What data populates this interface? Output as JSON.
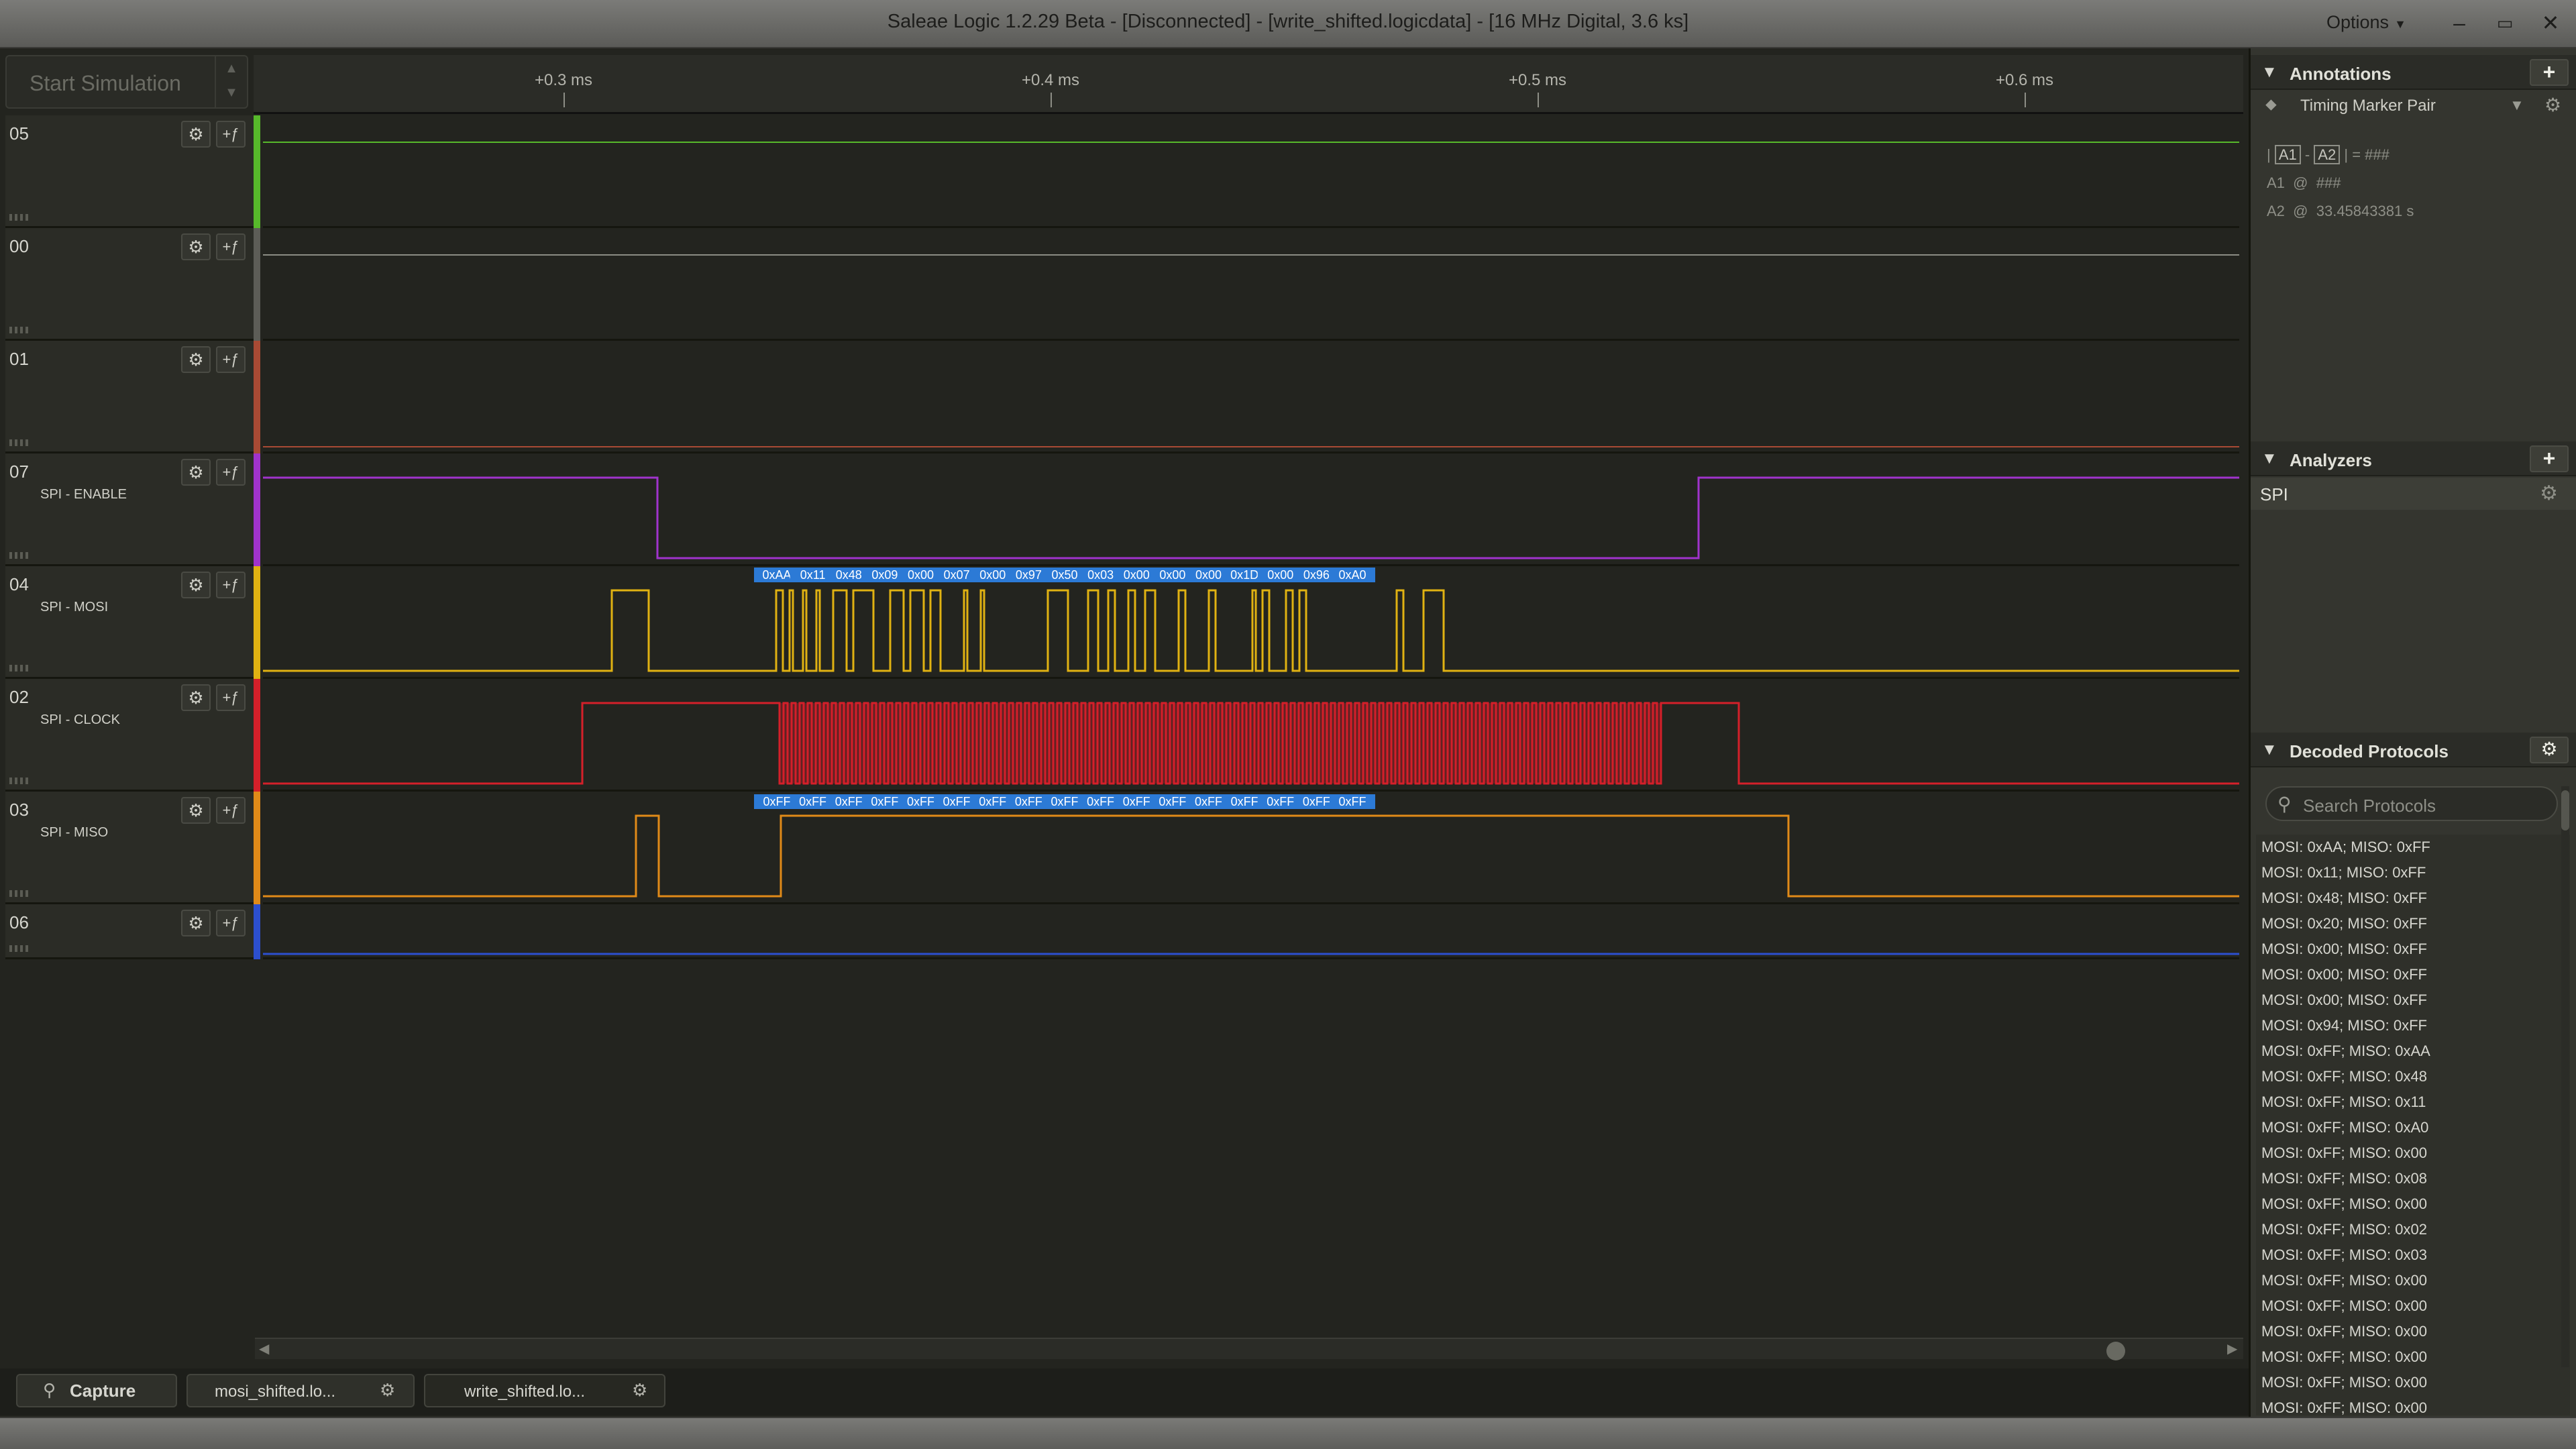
{
  "window": {
    "title": "Saleae Logic 1.2.29 Beta - [Disconnected] - [write_shifted.logicdata] - [16 MHz Digital, 3.6 ks]",
    "options_label": "Options",
    "minimize": "–",
    "restore": "▭",
    "close": "✕"
  },
  "toolbar": {
    "start_simulation": "Start Simulation"
  },
  "ruler": {
    "ticks": [
      "+0.3 ms",
      "+0.4 ms",
      "+0.5 ms",
      "+0.6 ms"
    ]
  },
  "channels": [
    {
      "num": "05",
      "name": "",
      "color": "#57b92b"
    },
    {
      "num": "00",
      "name": "",
      "color": "#5d5d57"
    },
    {
      "num": "01",
      "name": "",
      "color": "#a84a34"
    },
    {
      "num": "07",
      "name": "SPI - ENABLE",
      "color": "#a033cc"
    },
    {
      "num": "04",
      "name": "SPI - MOSI",
      "color": "#e0b212"
    },
    {
      "num": "02",
      "name": "SPI - CLOCK",
      "color": "#d4202a"
    },
    {
      "num": "03",
      "name": "SPI - MISO",
      "color": "#e08a18"
    },
    {
      "num": "06",
      "name": "",
      "color": "#2c4fcf"
    }
  ],
  "mosi_bytes": [
    "0xAA",
    "0x11",
    "0x48",
    "0x09",
    "0x00",
    "0x07",
    "0x00",
    "0x97",
    "0x50",
    "0x03",
    "0x00",
    "0x00",
    "0x00",
    "0x1D",
    "0x00",
    "0x96",
    "0xA0"
  ],
  "miso_bytes": [
    "0xFF",
    "0xFF",
    "0xFF",
    "0xFF",
    "0xFF",
    "0xFF",
    "0xFF",
    "0xFF",
    "0xFF",
    "0xFF",
    "0xFF",
    "0xFF",
    "0xFF",
    "0xFF",
    "0xFF",
    "0xFF",
    "0xFF"
  ],
  "tabs": {
    "capture": "Capture",
    "file1": "mosi_shifted.lo...",
    "file2": "write_shifted.lo..."
  },
  "annotations": {
    "header": "Annotations",
    "add": "+",
    "timing_marker": "Timing Marker Pair",
    "a1": "A1",
    "a2": "A2",
    "dash": "-",
    "equals_value": "= ###",
    "a1_line_at": "@",
    "a1_value": "###",
    "a2_value": "33.45843381 s"
  },
  "analyzers": {
    "header": "Analyzers",
    "add": "+",
    "items": [
      "SPI"
    ]
  },
  "decoded": {
    "header": "Decoded Protocols",
    "search_placeholder": "Search Protocols",
    "items": [
      "MOSI: 0xAA;  MISO: 0xFF",
      "MOSI: 0x11;  MISO: 0xFF",
      "MOSI: 0x48;  MISO: 0xFF",
      "MOSI: 0x20;  MISO: 0xFF",
      "MOSI: 0x00;  MISO: 0xFF",
      "MOSI: 0x00;  MISO: 0xFF",
      "MOSI: 0x00;  MISO: 0xFF",
      "MOSI: 0x94;  MISO: 0xFF",
      "MOSI: 0xFF;  MISO: 0xAA",
      "MOSI: 0xFF;  MISO: 0x48",
      "MOSI: 0xFF;  MISO: 0x11",
      "MOSI: 0xFF;  MISO: 0xA0",
      "MOSI: 0xFF;  MISO: 0x00",
      "MOSI: 0xFF;  MISO: 0x08",
      "MOSI: 0xFF;  MISO: 0x00",
      "MOSI: 0xFF;  MISO: 0x02",
      "MOSI: 0xFF;  MISO: 0x03",
      "MOSI: 0xFF;  MISO: 0x00",
      "MOSI: 0xFF;  MISO: 0x00",
      "MOSI: 0xFF;  MISO: 0x00",
      "MOSI: 0xFF;  MISO: 0x00",
      "MOSI: 0xFF;  MISO: 0x00",
      "MOSI: 0xFF;  MISO: 0x00"
    ]
  }
}
